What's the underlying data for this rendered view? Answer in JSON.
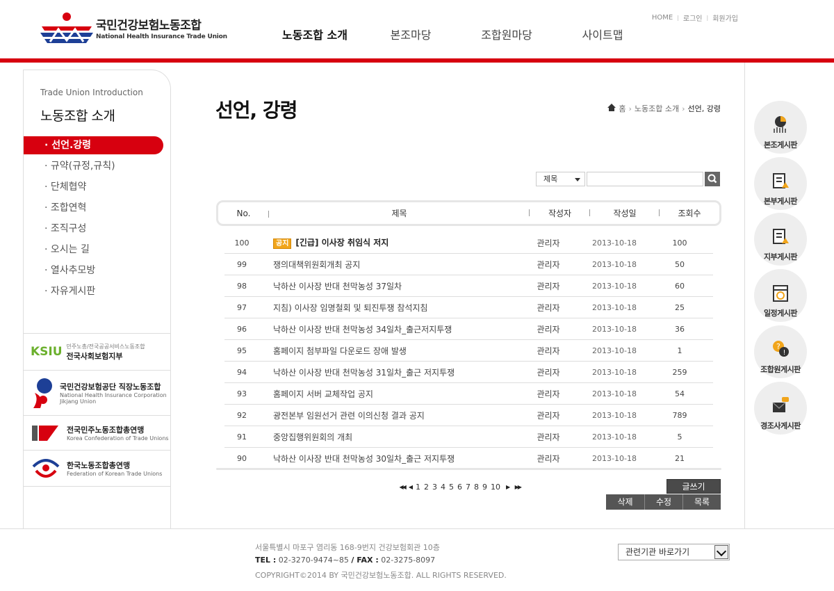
{
  "header": {
    "logo_kr": "국민건강보험노동조합",
    "logo_en": "National Health Insurance Trade Union",
    "gnb": [
      {
        "label": "노동조합 소개"
      },
      {
        "label": "본조마당"
      },
      {
        "label": "조합원마당"
      },
      {
        "label": "사이트맵"
      }
    ],
    "util": {
      "home": "HOME",
      "login": "로그인",
      "join": "회원가입"
    }
  },
  "sidebar": {
    "title_en": "Trade Union Introduction",
    "title": "노동조합 소개",
    "items": [
      {
        "label": "· 선언.강령"
      },
      {
        "label": "· 규약(규정,규칙)"
      },
      {
        "label": "· 단체협약"
      },
      {
        "label": "· 조합연혁"
      },
      {
        "label": "· 조직구성"
      },
      {
        "label": "· 오시는 길"
      },
      {
        "label": "· 열사추모방"
      },
      {
        "label": "· 자유게시판"
      }
    ],
    "banners": [
      {
        "logo": "KSIU",
        "small": "민주노총/전국공공서비스노동조합",
        "big": "전국사회보험지부"
      },
      {
        "big": "국민건강보험공단 직장노동조합",
        "en": "National Health Insurance Corporation Jikjang Union"
      },
      {
        "big": "전국민주노동조합총연맹",
        "en": "Korea Confederation of Trade Unions"
      },
      {
        "big": "한국노동조합총연맹",
        "en": "Federation of Korean Trade Unions"
      }
    ]
  },
  "main": {
    "page_title": "선언, 강령",
    "breadcrumb": [
      "홈",
      "노동조합 소개",
      "선언, 강령"
    ],
    "search": {
      "select_value": "제목",
      "placeholder": ""
    },
    "table": {
      "headers": [
        "No.",
        "제목",
        "작성자",
        "작성일",
        "조회수"
      ],
      "notice_badge": "공지",
      "rows": [
        {
          "no": "100",
          "title": "[긴급] 이사장 취임식 저지",
          "writer": "관리자",
          "date": "2013-10-18",
          "views": "100",
          "notice": true
        },
        {
          "no": "99",
          "title": "쟁의대책위원회개최 공지",
          "writer": "관리자",
          "date": "2013-10-18",
          "views": "50"
        },
        {
          "no": "98",
          "title": "낙하산 이사장 반대 천막농성 37일차",
          "writer": "관리자",
          "date": "2013-10-18",
          "views": "60"
        },
        {
          "no": "97",
          "title": " 지침) 이사장 임명철회 및 퇴진투쟁 참석지침",
          "writer": "관리자",
          "date": "2013-10-18",
          "views": "25"
        },
        {
          "no": "96",
          "title": "낙하산 이사장 반대 천막농성 34일차_출근저지투쟁",
          "writer": "관리자",
          "date": "2013-10-18",
          "views": "36"
        },
        {
          "no": "95",
          "title": "홈페이지 첨부파일 다운로드 장애 발생",
          "writer": "관리자",
          "date": "2013-10-18",
          "views": "1"
        },
        {
          "no": "94",
          "title": "낙하산 이사장 반대 천막농성 31일차_출근 저지투쟁",
          "writer": "관리자",
          "date": "2013-10-18",
          "views": "259"
        },
        {
          "no": "93",
          "title": "홈페이지 서버 교체작업 공지",
          "writer": "관리자",
          "date": "2013-10-18",
          "views": "54"
        },
        {
          "no": "92",
          "title": "광전본부 임원선거 관련 이의신청 결과 공지",
          "writer": "관리자",
          "date": "2013-10-18",
          "views": "789"
        },
        {
          "no": "91",
          "title": "중앙집행위원회의 개최",
          "writer": "관리자",
          "date": "2013-10-18",
          "views": "5"
        },
        {
          "no": "90",
          "title": " 낙하산 이사장 반대 천막농성 30일차_출근 저지투쟁",
          "writer": "관리자",
          "date": "2013-10-18",
          "views": "21"
        }
      ]
    },
    "paging": {
      "pages": [
        "1",
        "2",
        "3",
        "4",
        "5",
        "6",
        "7",
        "8",
        "9",
        "10"
      ]
    },
    "buttons": {
      "write": "글쓰기",
      "delete": "삭제",
      "edit": "수정",
      "list": "목록"
    }
  },
  "quick": [
    {
      "label": "본조게시판",
      "icon": "chart-icon"
    },
    {
      "label": "본부게시판",
      "icon": "board-icon"
    },
    {
      "label": "지부게시판",
      "icon": "board-icon"
    },
    {
      "label": "일정게시판",
      "icon": "calendar-icon"
    },
    {
      "label": "조합원게시판",
      "icon": "question-icon"
    },
    {
      "label": "경조사게시판",
      "icon": "envelope-icon"
    }
  ],
  "footer": {
    "address": "서울특별시 마포구 염리동 168-9번지 건강보험회관 10층",
    "tel_label": "TEL :",
    "tel": "02-3270-9474~85",
    "fax_label": "/ FAX :",
    "fax": "02-3275-8097",
    "copyright": "COPYRIGHT©2014 BY 국민건강보험노동조합. ALL RIGHTS RESERVED.",
    "related_select": "관련기관 바로가기"
  },
  "colors": {
    "accent": "#d7000f",
    "badge": "#f1a51b",
    "button": "#555555"
  }
}
